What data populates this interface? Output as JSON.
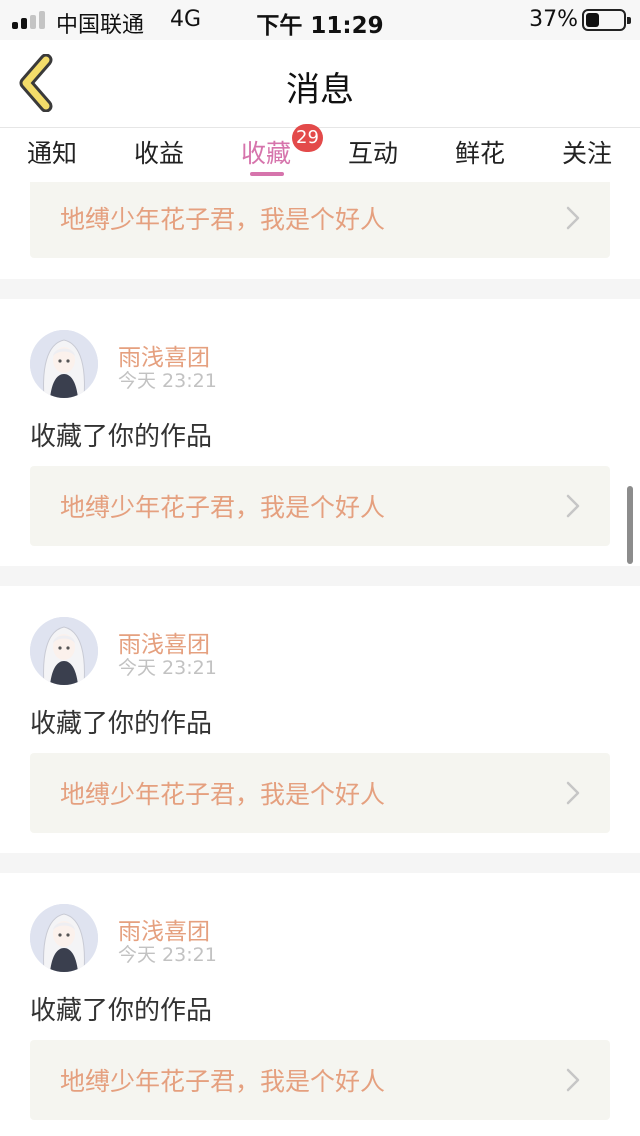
{
  "status_bar": {
    "carrier": "中国联通",
    "network": "4G",
    "time": "下午 11:29",
    "battery_percent": "37%",
    "battery_level": 0.37
  },
  "nav": {
    "title": "消息",
    "back_icon": "chevron-left-icon"
  },
  "tabs": [
    {
      "label": "通知",
      "active": false
    },
    {
      "label": "收益",
      "active": false
    },
    {
      "label": "收藏",
      "active": true,
      "badge": "29"
    },
    {
      "label": "互动",
      "active": false
    },
    {
      "label": "鲜花",
      "active": false
    },
    {
      "label": "关注",
      "active": false
    }
  ],
  "colors": {
    "accent": "#d674ac",
    "username": "#e5a07f",
    "badge": "#e34a4a"
  },
  "top_partial_card": {
    "work_title": "地缚少年花子君，我是个好人"
  },
  "notifications": [
    {
      "username": "雨浅喜团",
      "time": "今天 23:21",
      "action": "收藏了你的作品",
      "work_title": "地缚少年花子君，我是个好人"
    },
    {
      "username": "雨浅喜团",
      "time": "今天 23:21",
      "action": "收藏了你的作品",
      "work_title": "地缚少年花子君，我是个好人"
    },
    {
      "username": "雨浅喜团",
      "time": "今天 23:21",
      "action": "收藏了你的作品",
      "work_title": "地缚少年花子君，我是个好人"
    }
  ]
}
